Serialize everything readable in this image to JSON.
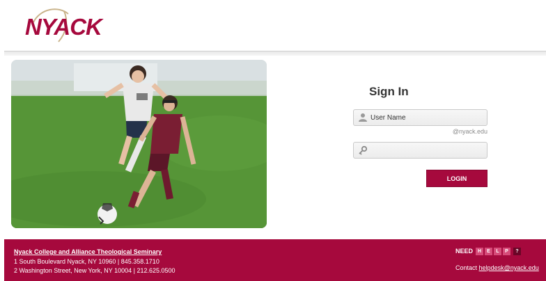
{
  "header": {
    "logo_text": "NYACK"
  },
  "signin": {
    "title": "Sign In",
    "username_placeholder": "User Name",
    "password_placeholder": "",
    "domain_hint": "@nyack.edu",
    "login_label": "LOGIN"
  },
  "footer": {
    "college_name": "Nyack College and Alliance Theological Seminary",
    "address_1": "1 South Boulevard Nyack, NY 10960 | 845.358.1710",
    "address_2": "2 Washington Street, New York, NY 10004 | 212.625.0500",
    "need_label": "NEED",
    "help_letters": [
      "H",
      "E",
      "L",
      "P"
    ],
    "help_question": "?",
    "contact_label": "Contact",
    "helpdesk_email": "helpdesk@nyack.edu"
  },
  "colors": {
    "brand": "#a6093d",
    "help_letter_bg": "#d64b79"
  },
  "icons": {
    "username": "user-icon",
    "password": "key-icon"
  }
}
